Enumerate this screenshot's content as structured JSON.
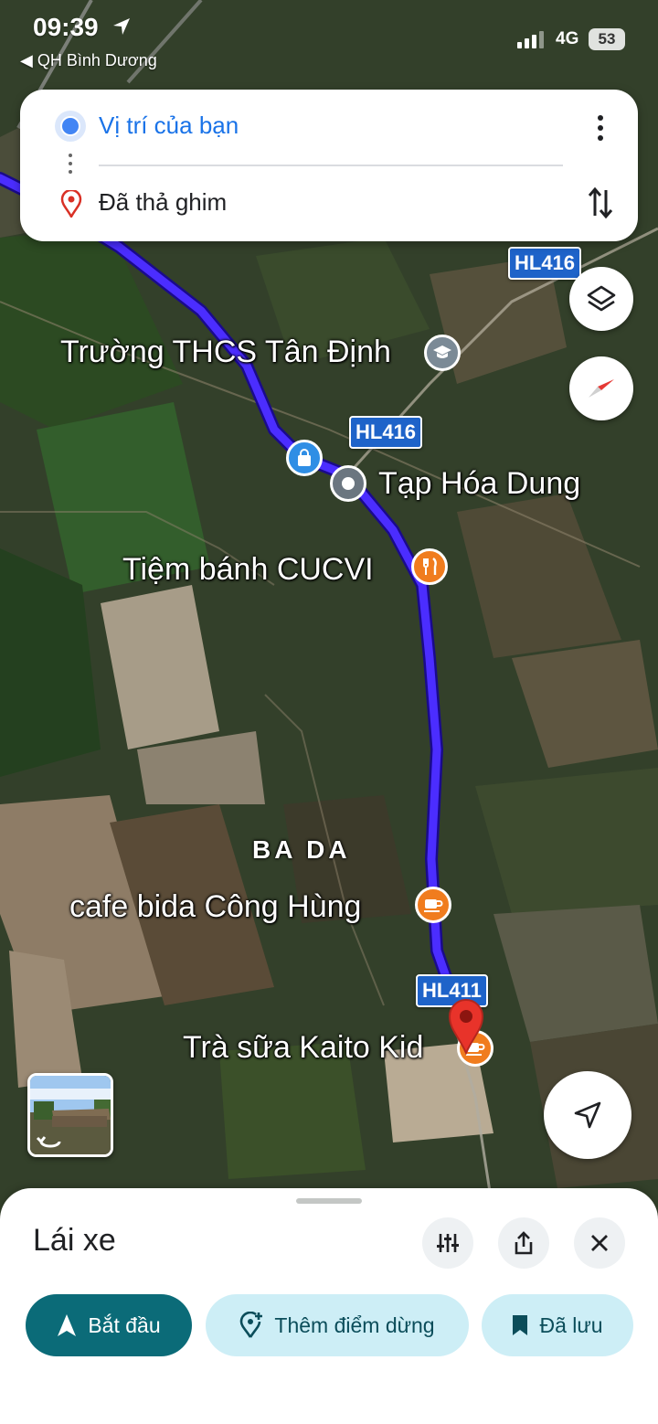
{
  "status_bar": {
    "time": "09:39",
    "back_app": "◀ QH Bình Dương",
    "network": "4G",
    "battery": "53"
  },
  "route": {
    "origin": "Vị trí của bạn",
    "destination": "Đã thả ghim"
  },
  "map": {
    "places": [
      "Trường THCS Tân Định",
      "Tạp Hóa Dung",
      "Tiệm bánh CUCVI",
      "cafe bida Công Hùng",
      "Trà sữa Kaito Kid"
    ],
    "area": "BA DA",
    "roads": [
      "HL416",
      "HL416",
      "HL411"
    ],
    "route_color": "#3b1de0"
  },
  "sheet": {
    "mode": "Lái xe",
    "start": "Bắt đầu",
    "add_stop": "Thêm điểm dừng",
    "saved": "Đã lưu"
  },
  "icons": [
    "navigation-arrow-icon",
    "more-vert-icon",
    "swap-vertical-icon",
    "layers-icon",
    "compass-icon",
    "my-location-icon",
    "tune-icon",
    "share-icon",
    "close-icon"
  ]
}
